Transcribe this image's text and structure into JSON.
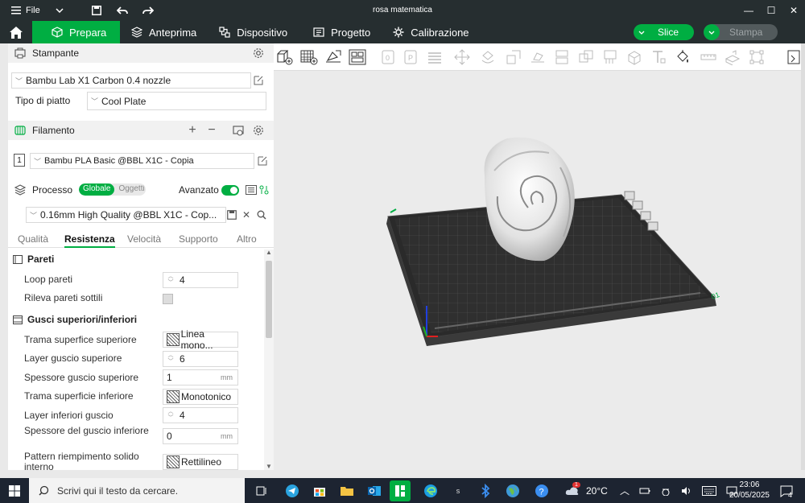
{
  "titlebar": {
    "file_label": "File",
    "window_title": "rosa matematica"
  },
  "nav": {
    "tabs": [
      {
        "label": "Prepara"
      },
      {
        "label": "Anteprima"
      },
      {
        "label": "Dispositivo"
      },
      {
        "label": "Progetto"
      },
      {
        "label": "Calibrazione"
      }
    ],
    "slice_label": "Slice",
    "print_label": "Stampa"
  },
  "printer": {
    "section_title": "Stampante",
    "printer_name": "Bambu Lab X1 Carbon 0.4 nozzle",
    "plate_label": "Tipo di piatto",
    "plate_value": "Cool Plate"
  },
  "filament": {
    "section_title": "Filamento",
    "slot_number": "1",
    "filament_name": "Bambu PLA Basic @BBL X1C - Copia"
  },
  "process": {
    "section_title": "Processo",
    "seg_global": "Globale",
    "seg_objects": "Oggetti",
    "advanced_label": "Avanzato",
    "profile_name": "0.16mm High Quality @BBL X1C - Cop..."
  },
  "settings_tabs": [
    "Qualità",
    "Resistenza",
    "Velocità",
    "Supporto",
    "Altro"
  ],
  "settings": {
    "walls_group": "Pareti",
    "wall_loops_label": "Loop pareti",
    "wall_loops_value": "4",
    "thin_walls_label": "Rileva pareti sottili",
    "shells_group": "Gusci superiori/inferiori",
    "top_pattern_label": "Trama superfice superiore",
    "top_pattern_value": "Linea mono...",
    "top_layers_label": "Layer guscio superiore",
    "top_layers_value": "6",
    "top_thickness_label": "Spessore guscio superiore",
    "top_thickness_value": "1",
    "bottom_pattern_label": "Trama superficie inferiore",
    "bottom_pattern_value": "Monotonico",
    "bottom_layers_label": "Layer inferiori guscio",
    "bottom_layers_value": "4",
    "bottom_thickness_label": "Spessore del guscio inferiore",
    "bottom_thickness_value": "0",
    "infill_pattern_label": "Pattern riempimento solido interno",
    "infill_pattern_value": "Rettilineo",
    "unit_mm": "mm"
  },
  "viewport": {
    "plate_number": "01"
  },
  "taskbar": {
    "search_placeholder": "Scrivi qui il testo da cercare.",
    "weather": "20°C",
    "notification_count": "1",
    "time": "23:06",
    "date": "20/05/2025",
    "notification_center_count": "4"
  },
  "colors": {
    "accent": "#00ae42",
    "titlebar": "#262e30",
    "taskbar": "#1d2431"
  }
}
